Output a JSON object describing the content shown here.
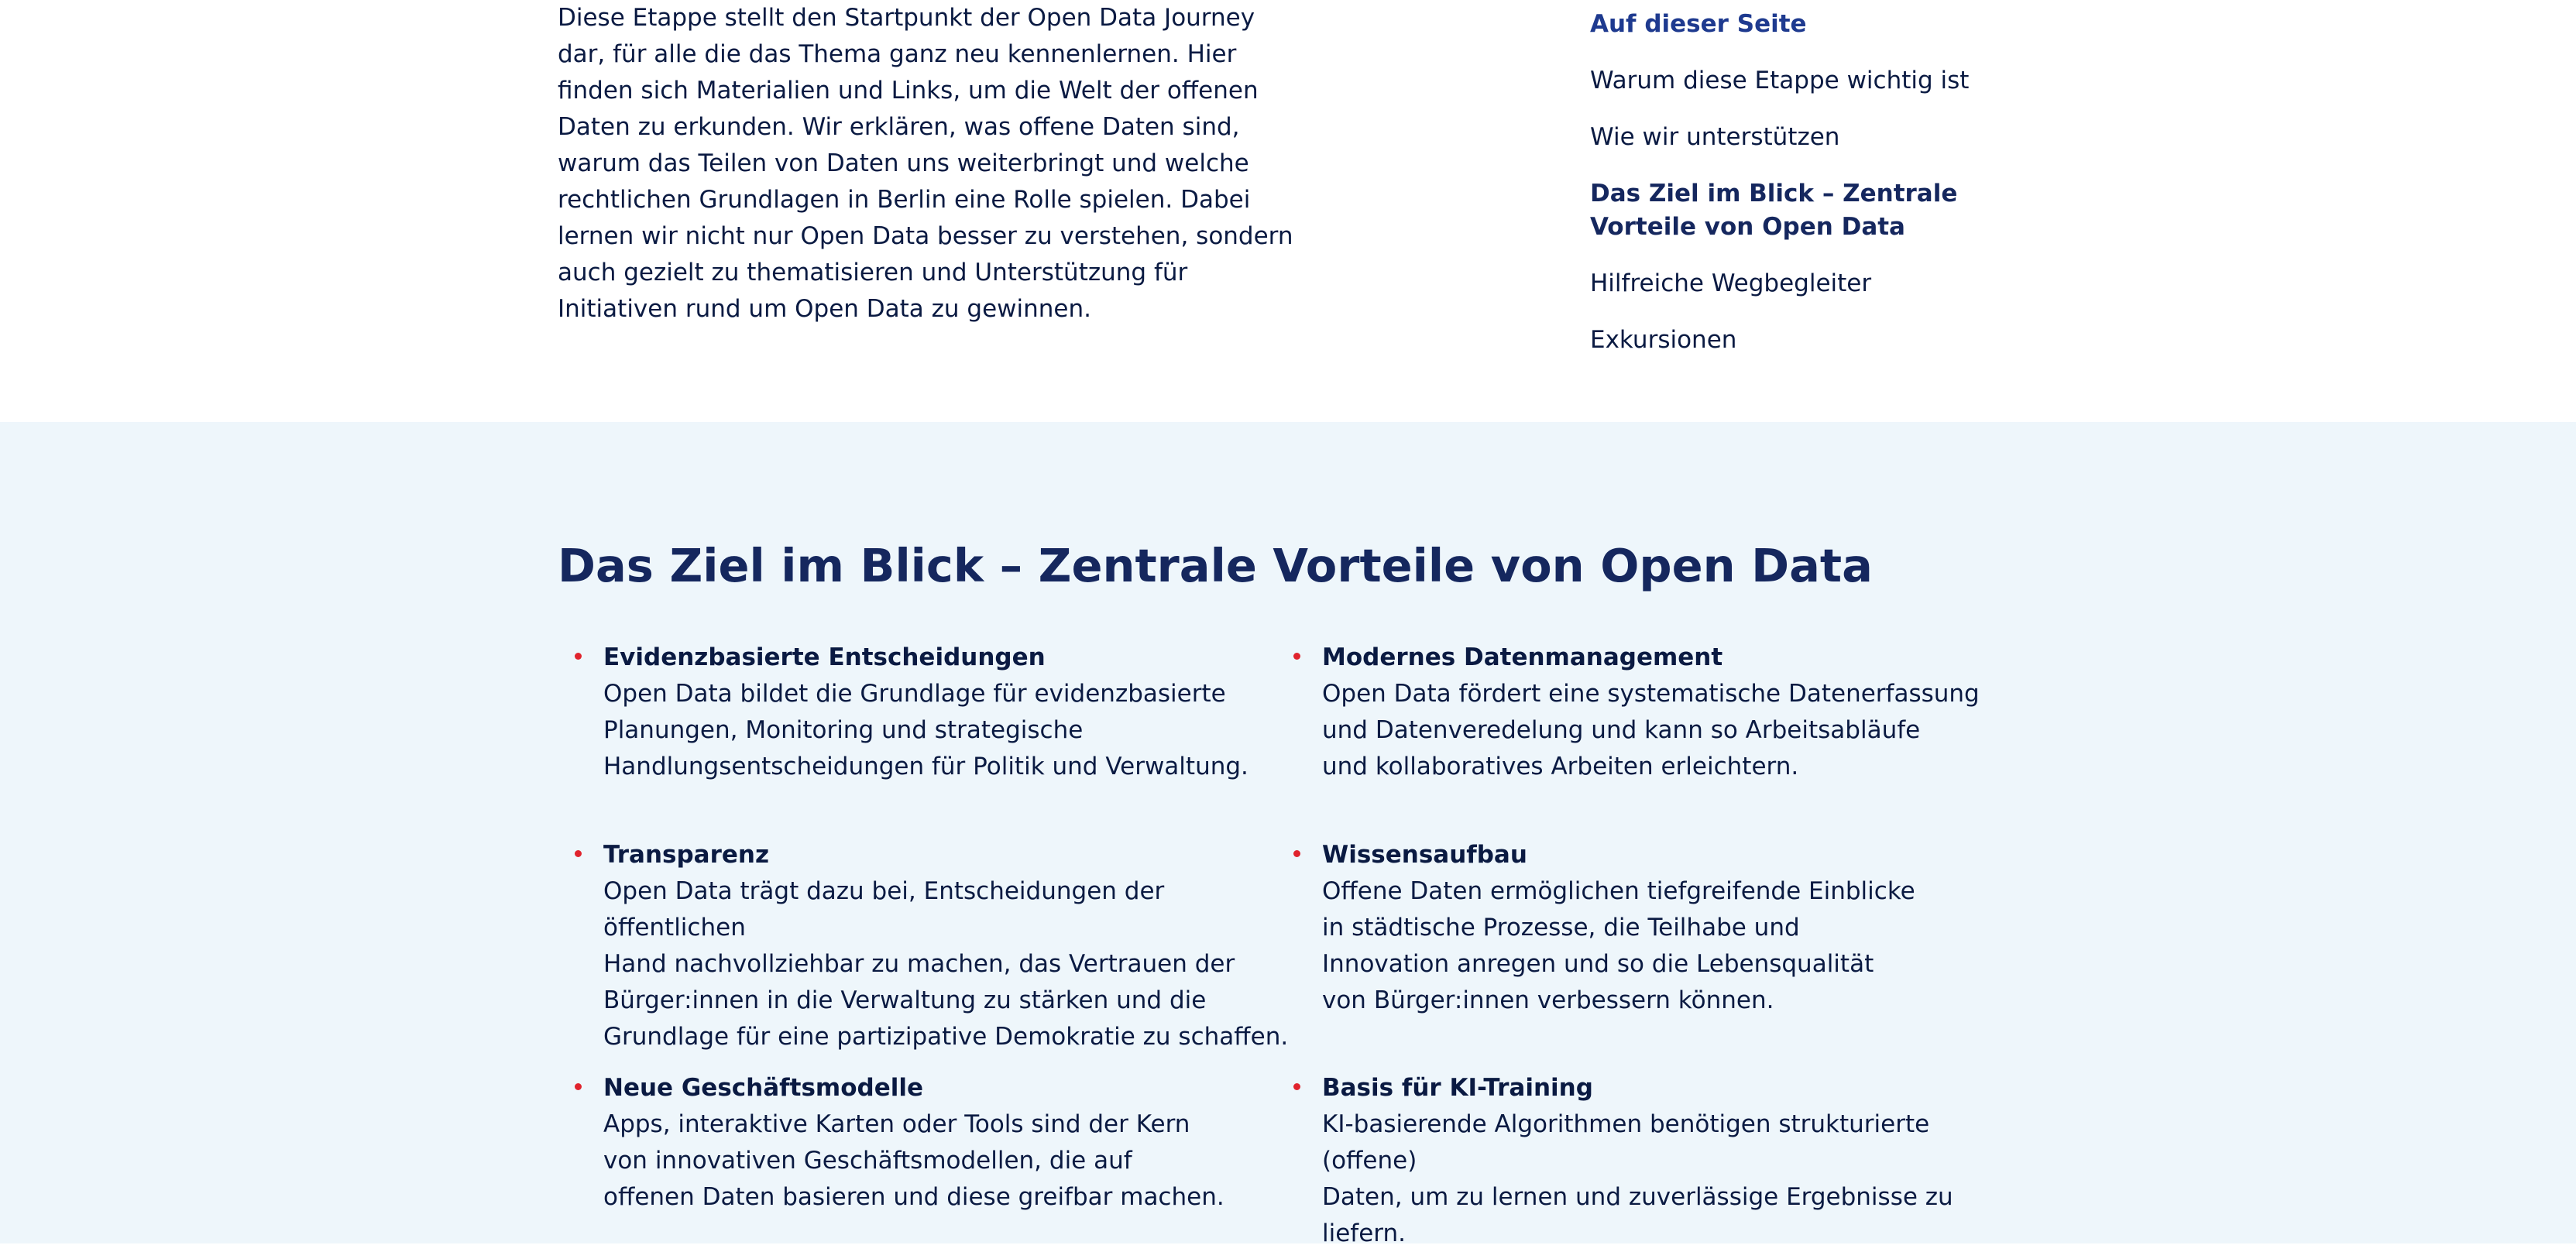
{
  "intro": {
    "text": "Diese Etappe stellt den Startpunkt der Open Data Journey dar, für alle die das Thema ganz neu kennenlernen. Hier finden sich Materialien und Links, um die Welt der offenen Daten zu erkunden. Wir erklären, was offene Daten sind, warum das Teilen von Daten uns weiterbringt und welche rechtlichen Grundlagen in Berlin eine Rolle spielen. Dabei lernen wir nicht nur Open Data besser zu verstehen, sondern auch gezielt zu thematisieren und Unterstützung für Initiativen rund um Open Data zu gewinnen."
  },
  "toc": {
    "heading": "Auf dieser Seite",
    "items": [
      {
        "label": "Warum diese Etappe wichtig ist"
      },
      {
        "label": "Wie wir unterstützen"
      },
      {
        "label": "Das Ziel im Blick – Zentrale Vorteile von Open Data"
      },
      {
        "label": "Hilfreiche Wegbegleiter"
      },
      {
        "label": "Exkursionen"
      }
    ]
  },
  "benefits_section": {
    "title": "Das Ziel im Blick – Zentrale Vorteile von Open Data",
    "items": [
      {
        "title": "Evidenzbasierte Entscheidungen",
        "text": "Open Data bildet die Grundlage für evidenzbasierte\nPlanungen, Monitoring und strategische\nHandlungsentscheidungen für Politik und Verwaltung."
      },
      {
        "title": "Modernes Datenmanagement",
        "text": "Open Data fördert eine systematische Datenerfassung\nund Datenveredelung und kann so Arbeitsabläufe\nund kollaboratives Arbeiten erleichtern."
      },
      {
        "title": "Transparenz",
        "text": "Open Data trägt dazu bei, Entscheidungen der öffentlichen\nHand nachvollziehbar zu machen, das Vertrauen der\nBürger:innen in die Verwaltung zu stärken und die\nGrundlage für eine partizipative Demokratie zu schaffen."
      },
      {
        "title": "Wissensaufbau",
        "text": "Offene Daten ermöglichen tiefgreifende Einblicke\nin städtische Prozesse, die Teilhabe und\nInnovation anregen und so die Lebensqualität\nvon Bürger:innen verbessern können."
      },
      {
        "title": "Neue Geschäftsmodelle",
        "text": "Apps, interaktive Karten oder Tools sind der Kern\nvon innovativen Geschäftsmodellen, die auf\noffenen Daten basieren und diese greifbar machen."
      },
      {
        "title": "Basis für KI-Training",
        "text": "KI-basierende Algorithmen benötigen strukturierte (offene)\nDaten, um zu lernen und zuverlässige Ergebnisse zu liefern."
      }
    ]
  },
  "colors": {
    "heading": "#15275e",
    "toc_heading": "#1e3a8f",
    "text": "#0a1a42",
    "bullet": "#e0232d",
    "section_background": "#eef6fb"
  }
}
